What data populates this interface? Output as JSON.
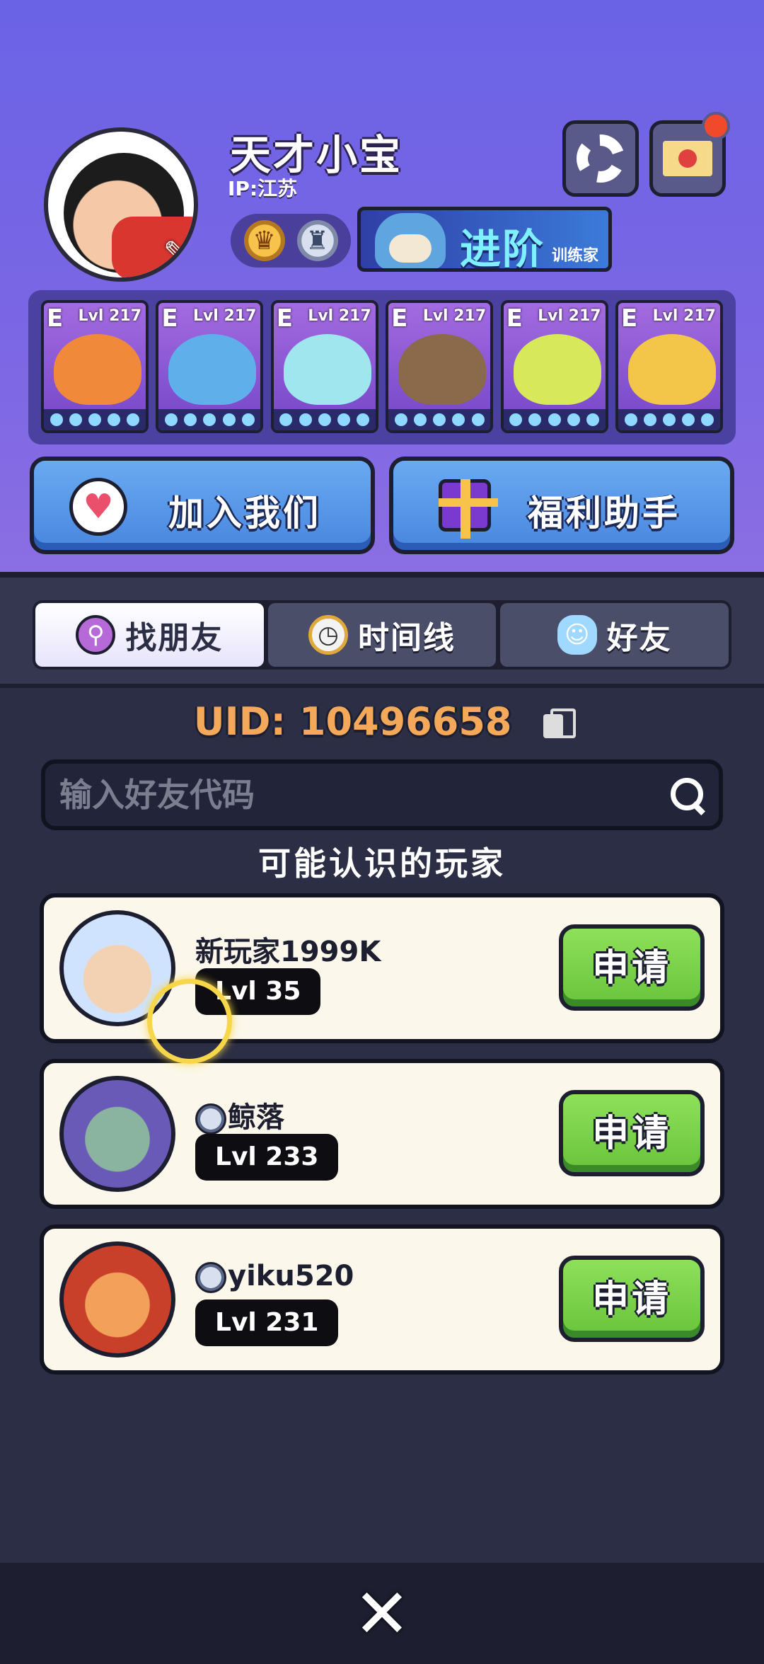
{
  "profile": {
    "username": "天才小宝",
    "ip_label": "IP:江苏",
    "advance_label": "进阶",
    "advance_sub": "训练家"
  },
  "cards": [
    {
      "rank": "E",
      "level": "Lvl 217",
      "color": "#f08a3a"
    },
    {
      "rank": "E",
      "level": "Lvl 217",
      "color": "#5fb0ea"
    },
    {
      "rank": "E",
      "level": "Lvl 217",
      "color": "#9fe6ef"
    },
    {
      "rank": "E",
      "level": "Lvl 217",
      "color": "#8a6a4a"
    },
    {
      "rank": "E",
      "level": "Lvl 217",
      "color": "#d7e85a"
    },
    {
      "rank": "E",
      "level": "Lvl 217",
      "color": "#f3c64a"
    }
  ],
  "buttons": {
    "join": "加入我们",
    "welfare": "福利助手"
  },
  "tabs": [
    {
      "label": "找朋友",
      "active": true
    },
    {
      "label": "时间线",
      "active": false
    },
    {
      "label": "好友",
      "active": false
    }
  ],
  "uid_text": "UID:  10496658",
  "search": {
    "placeholder": "输入好友代码"
  },
  "section_title": "可能认识的玩家",
  "players": [
    {
      "name": "新玩家1999K",
      "level": "Lvl 35",
      "apply": "申请",
      "avatar_color": "#cfe3ff"
    },
    {
      "name": "鲸落",
      "level": "Lvl 233",
      "apply": "申请",
      "avatar_color": "#6a5ab8"
    },
    {
      "name": "yiku520",
      "level": "Lvl 231",
      "apply": "申请",
      "avatar_color": "#e65a3a"
    }
  ],
  "colors": {
    "accent_orange": "#f4a859",
    "apply_green": "#7ad34a",
    "purple_bg": "#7266e4"
  }
}
